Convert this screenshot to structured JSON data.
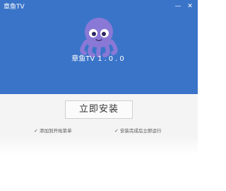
{
  "window": {
    "title": "章鱼TV",
    "minimize_glyph": "—",
    "close_glyph": "✕"
  },
  "brand": {
    "name": "章鱼TV",
    "version": "1.0.0",
    "accent_color": "#3a74c8",
    "mascot_color": "#8a78d6",
    "mascot_icon": "octopus-mascot-icon"
  },
  "install": {
    "button_label": "立即安装"
  },
  "options": [
    {
      "label": "添加到开始菜单",
      "checked": true
    },
    {
      "label": "安装完成后立即运行",
      "checked": true
    }
  ]
}
